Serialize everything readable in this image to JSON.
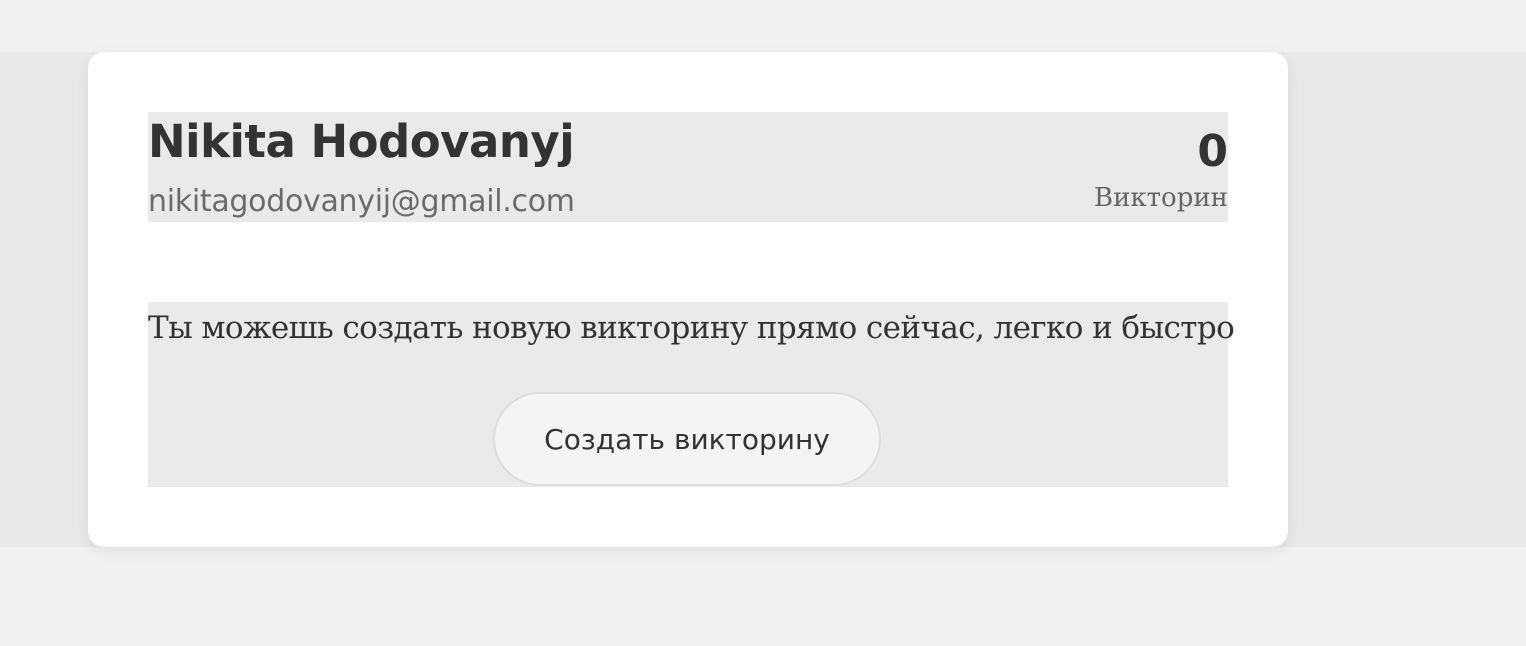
{
  "profile": {
    "name": "Nikita Hodovanyj",
    "email": "nikitagodovanyij@gmail.com",
    "quiz_count": "0",
    "quiz_count_label": "Викторин"
  },
  "create": {
    "text": "Ты можешь создать новую викторину прямо сейчас, легко и быстро",
    "button_label": "Создать викторину"
  },
  "colors": {
    "page_background": "#f1f1f1",
    "band_background": "#e9e9e9",
    "card_background": "#ffffff",
    "block_background": "#eaeaea",
    "text_primary": "#333333"
  }
}
